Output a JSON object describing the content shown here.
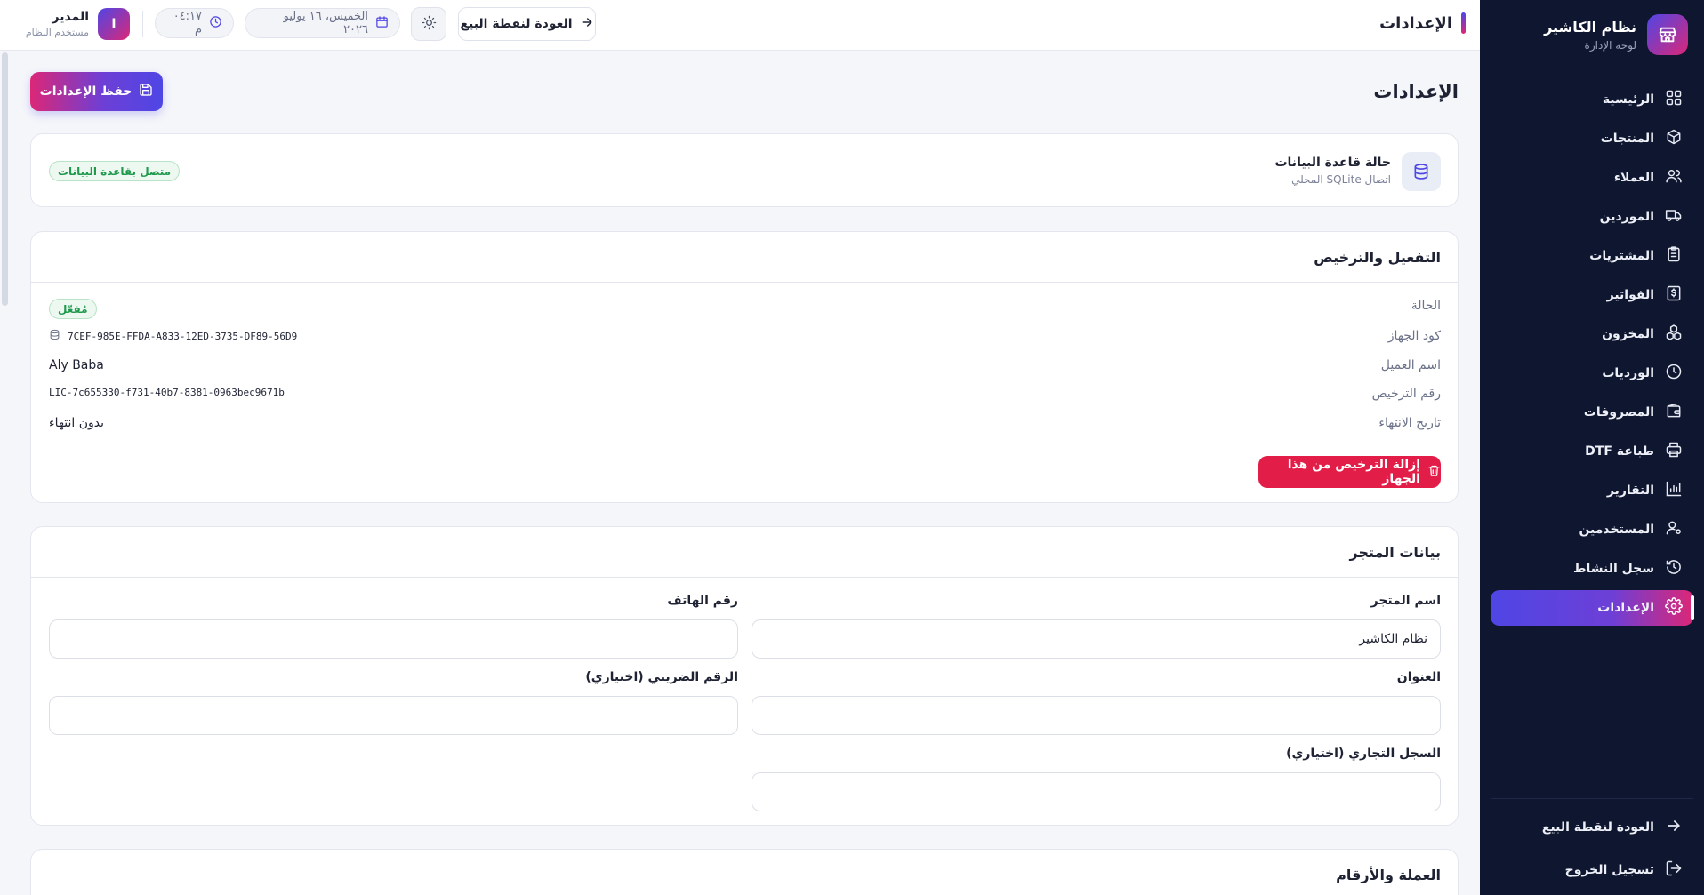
{
  "sidebar": {
    "brand_name": "نظام الكاشير",
    "brand_sub": "لوحة الإدارة",
    "items": [
      {
        "label": "الرئيسية",
        "icon": "grid-icon"
      },
      {
        "label": "المنتجات",
        "icon": "box-icon"
      },
      {
        "label": "العملاء",
        "icon": "users-icon"
      },
      {
        "label": "الموردين",
        "icon": "truck-icon"
      },
      {
        "label": "المشتريات",
        "icon": "clipboard-icon"
      },
      {
        "label": "الفواتير",
        "icon": "receipt-icon"
      },
      {
        "label": "المخزون",
        "icon": "boxes-icon"
      },
      {
        "label": "الورديات",
        "icon": "clock-icon"
      },
      {
        "label": "المصروفات",
        "icon": "wallet-icon"
      },
      {
        "label": "طباعة DTF",
        "icon": "printer-icon"
      },
      {
        "label": "التقارير",
        "icon": "bar-chart-icon"
      },
      {
        "label": "المستخدمين",
        "icon": "user-cog-icon"
      },
      {
        "label": "سجل النشاط",
        "icon": "history-icon"
      },
      {
        "label": "الإعدادات",
        "icon": "gear-icon",
        "active": true
      }
    ],
    "bottom": {
      "back_to_pos": "العودة لنقطة البيع",
      "logout": "تسجيل الخروج"
    }
  },
  "topbar": {
    "title": "الإعدادات",
    "back_to_pos": "العودة لنقطة البيع",
    "date": "الخميس، ١٦ يوليو ٢٠٢٦",
    "time": "٠٤:١٧ م",
    "user": {
      "initial": "ا",
      "name": "المدير",
      "role": "مستخدم النظام"
    }
  },
  "page": {
    "title": "الإعدادات",
    "save_button": "حفظ الإعدادات"
  },
  "database": {
    "title": "حالة قاعدة البيانات",
    "subtitle": "اتصال SQLite المحلي",
    "status": "متصل بقاعدة البيانات"
  },
  "license": {
    "title": "التفعيل والترخيص",
    "rows": {
      "status_label": "الحالة",
      "status_value": "مُفعّل",
      "device_code_label": "كود الجهاز",
      "device_code_value": "7CEF-985E-FFDA-A833-12ED-3735-DF89-56D9",
      "customer_name_label": "اسم العميل",
      "customer_name_value": "Aly Baba",
      "license_number_label": "رقم الترخيص",
      "license_number_value": "LIC-7c655330-f731-40b7-8381-0963bec9671b",
      "expiry_label": "تاريخ الانتهاء",
      "expiry_value": "بدون انتهاء"
    },
    "remove_button": "إزالة الترخيص من هذا الجهاز"
  },
  "store": {
    "title": "بيانات المتجر",
    "store_name_label": "اسم المتجر",
    "store_name_value": "نظام الكاشير",
    "phone_label": "رقم الهاتف",
    "phone_value": "",
    "address_label": "العنوان",
    "address_value": "",
    "tax_label": "الرقم الضريبي (اختياري)",
    "tax_value": "",
    "commercial_label": "السجل التجاري (اختياري)",
    "commercial_value": ""
  },
  "currency": {
    "title": "العملة والأرقام"
  },
  "colors": {
    "sidebar_bg": "#0f1630",
    "accent_start": "#4f46e5",
    "accent_end": "#db2777",
    "success": "#1f9a4d",
    "danger": "#e11d48"
  }
}
